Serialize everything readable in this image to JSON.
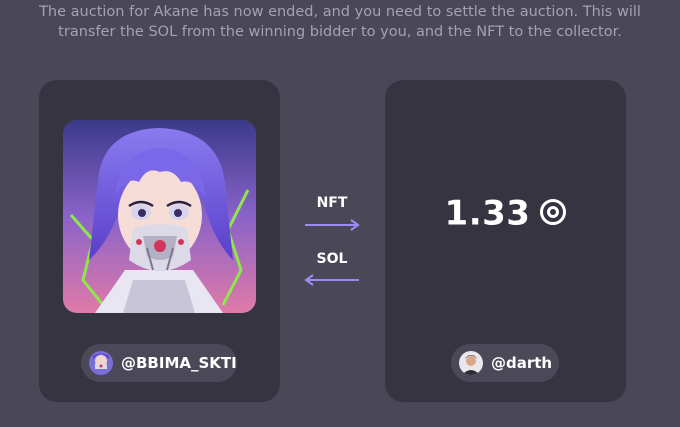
{
  "notice": {
    "line1": "The auction for Akane has now ended, and you need to settle the auction. This will",
    "line2": "transfer the SOL from the winning bidder to you, and the NFT to the collector."
  },
  "seller": {
    "handle": "@BBIMA_SKTI",
    "avatar_icon": "user-avatar-icon"
  },
  "transfer": {
    "nft_label": "NFT",
    "sol_label": "SOL",
    "arrow_color": "#9b8cf5"
  },
  "winner": {
    "amount": "1.33",
    "currency_icon": "sol-icon",
    "handle": "@darth",
    "avatar_icon": "user-avatar-icon"
  },
  "colors": {
    "background": "#4a4757",
    "card": "#363441",
    "pill": "#4b4957",
    "accent": "#9b8cf5"
  }
}
